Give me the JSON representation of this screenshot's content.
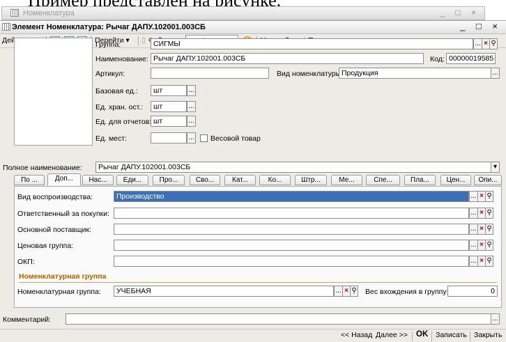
{
  "document_caption": "Пример представлен на рисунке.",
  "outer_window": {
    "title": "Номенклатура",
    "controls": "_ □ ×"
  },
  "window": {
    "title": "Элемент Номенклатура: Рычаг ДАПУ.102001.003СБ",
    "controls": "_ □ ×"
  },
  "toolbar": {
    "actions": "Действия ▾",
    "goto": "Перейти ▾",
    "files": "Файлы",
    "image": "Изображение",
    "help": "?",
    "settings": "Настройка...",
    "print": "Печать ▾"
  },
  "header": {
    "group_label": "Группа:",
    "group_value": "СИГМЫ",
    "name_label": "Наименование:",
    "name_value": "Рычаг ДАПУ.102001.003СБ",
    "code_label": "Код:",
    "code_value": "00000019585",
    "article_label": "Артикул:",
    "article_value": "",
    "kind_label": "Вид номенклатуры:",
    "kind_value": "Продукция",
    "base_unit_label": "Базовая ед.:",
    "base_unit_value": "шт",
    "storage_unit_label": "Ед. хран. ост.:",
    "storage_unit_value": "шт",
    "report_unit_label": "Ед. для отчетов:",
    "report_unit_value": "шт",
    "places_unit_label": "Ед. мест:",
    "places_unit_value": "",
    "weight_label": "Весовой товар",
    "fullname_label": "Полное наименование:",
    "fullname_value": "Рычаг ДАПУ.102001.003СБ"
  },
  "tabs": [
    "По ...",
    "Доп...",
    "Нас...",
    "Еди...",
    "Про...",
    "Сво...",
    "Кат...",
    "Ко...",
    "Штр...",
    "Ме...",
    "Спе...",
    "Пла...",
    "Цен...",
    "Опи..."
  ],
  "active_tab_index": 1,
  "panel": {
    "reproduction_label": "Вид воспроизводства:",
    "reproduction_value": "Производство",
    "buyer_label": "Ответственный за покупки:",
    "buyer_value": "",
    "supplier_label": "Основной поставщик:",
    "supplier_value": "",
    "price_group_label": "Ценовая группа:",
    "price_group_value": "",
    "okp_label": "ОКП:",
    "okp_value": "",
    "section_title": "Номенклатурная группа",
    "nom_group_label": "Номенклатурная группа:",
    "nom_group_value": "УЧЕБНАЯ",
    "weight_in_group_label": "Вес вхождения в группу:",
    "weight_in_group_value": "0"
  },
  "comment": {
    "label": "Комментарий:",
    "value": ""
  },
  "status_bar": {
    "back": "<< Назад",
    "next": "Далее >>",
    "ok": "OK",
    "save": "Записать",
    "close": "Закрыть"
  }
}
